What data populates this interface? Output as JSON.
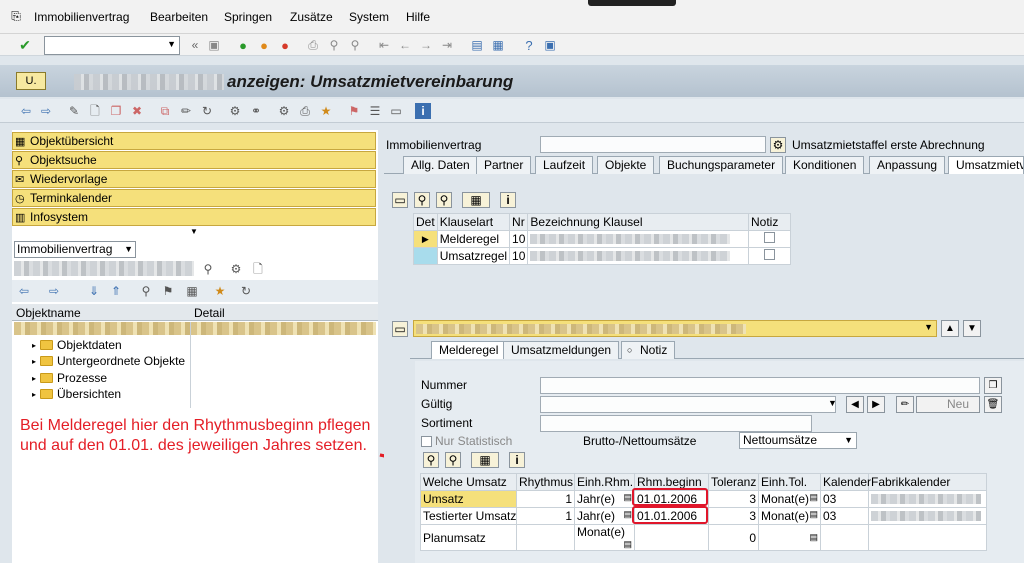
{
  "menu": [
    "Immobilienvertrag",
    "Bearbeiten",
    "Springen",
    "Zusätze",
    "System",
    "Hilfe"
  ],
  "title": "anzeigen: Umsatzmietvereinbarung",
  "nav": {
    "items": [
      "Objektübersicht",
      "Objektsuche",
      "Wiedervorlage",
      "Terminkalender",
      "Infosystem"
    ],
    "object_type": "Immobilienvertrag",
    "tree_headers": [
      "Objektname",
      "Detail"
    ],
    "tree_nodes": [
      "Objektdaten",
      "Untergeordnete Objekte",
      "Prozesse",
      "Übersichten"
    ]
  },
  "header": {
    "contract_label": "Immobilienvertrag",
    "staffel_label": "Umsatzmietstaffel erste Abrechnung"
  },
  "tabs": [
    "Allg. Daten",
    "Partner",
    "Laufzeit",
    "Objekte",
    "Buchungsparameter",
    "Konditionen",
    "Anpassung",
    "Umsatzmietv"
  ],
  "clause_table": {
    "headers": [
      "Det",
      "Klauselart",
      "Nr",
      "Bezeichnung Klausel",
      "Notiz"
    ],
    "rows": [
      {
        "klauselart": "Melderegel",
        "nr": "10"
      },
      {
        "klauselart": "Umsatzregel",
        "nr": "10"
      }
    ]
  },
  "subtabs": [
    "Melderegel",
    "Umsatzmeldungen",
    "Notiz"
  ],
  "form": {
    "nummer": "Nummer",
    "gueltig": "Gültig",
    "sortiment": "Sortiment",
    "nur_statistisch": "Nur Statistisch",
    "brutto_label": "Brutto-/Nettoumsätze",
    "brutto_value": "Nettoumsätze",
    "neu": "Neu"
  },
  "sales_table": {
    "headers": [
      "Welche Umsatz",
      "Rhythmus",
      "Einh.Rhm.",
      "Rhm.beginn",
      "Toleranz",
      "Einh.Tol.",
      "Kalender",
      "Fabrikkalender"
    ],
    "rows": [
      {
        "welche": "Umsatz",
        "rhythmus": "1",
        "einh": "Jahr(e)",
        "beginn": "01.01.2006",
        "toleranz": "3",
        "einhtol": "Monat(e)",
        "kalender": "03"
      },
      {
        "welche": "Testierter Umsatz",
        "rhythmus": "1",
        "einh": "Jahr(e)",
        "beginn": "01.01.2006",
        "toleranz": "3",
        "einhtol": "Monat(e)",
        "kalender": "03"
      },
      {
        "welche": "Planumsatz",
        "rhythmus": "",
        "einh": "Monat(e)",
        "beginn": "",
        "toleranz": "0",
        "einhtol": "",
        "kalender": ""
      }
    ]
  },
  "annotation": "Bei Melderegel hier den Rhythmusbeginn pflegen und auf den 01.01. des jeweiligen Jahres setzen.",
  "colors": {
    "annotation": "#e41e26",
    "nav": "#f5e07b",
    "highlight": "#f5e07b"
  }
}
